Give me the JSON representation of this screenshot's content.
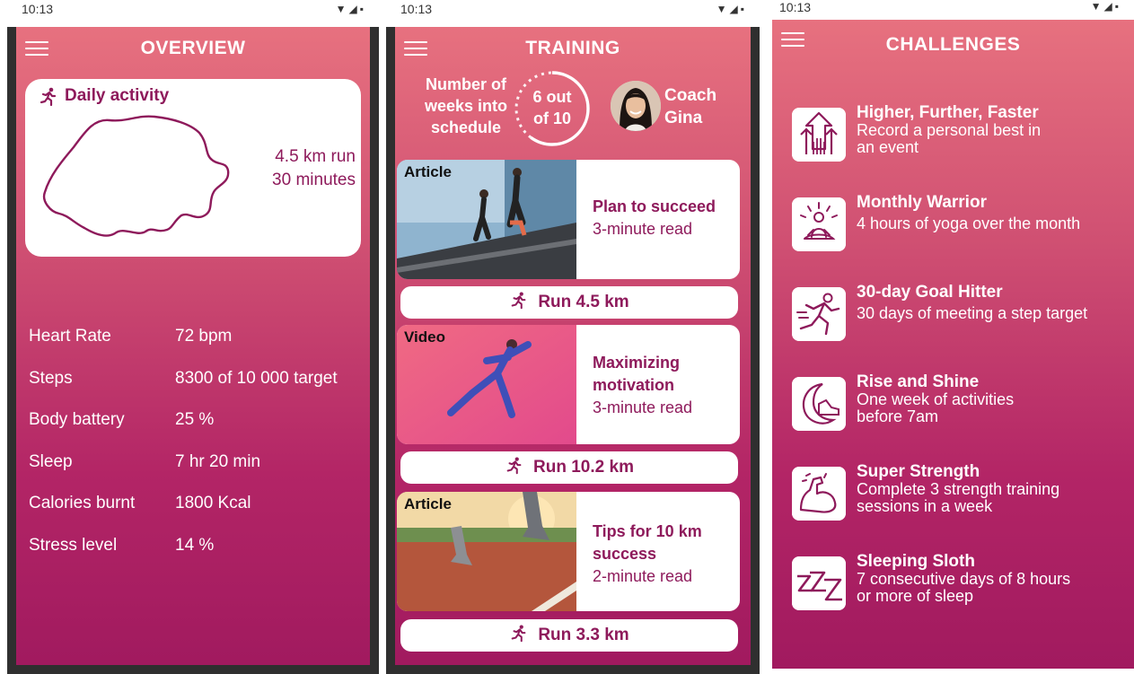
{
  "overview": {
    "status_time": "10:13",
    "title": "OVERVIEW",
    "daily": {
      "title": "Daily activity",
      "distance": "4.5 km run",
      "duration": "30 minutes"
    },
    "metrics": [
      {
        "label": "Heart Rate",
        "value": "72 bpm"
      },
      {
        "label": "Steps",
        "value": "8300 of 10 000 target"
      },
      {
        "label": "Body battery",
        "value": "25 %"
      },
      {
        "label": "Sleep",
        "value": "7 hr 20 min"
      },
      {
        "label": "Calories burnt",
        "value": "1800 Kcal"
      },
      {
        "label": "Stress level",
        "value": "14 %"
      }
    ]
  },
  "training": {
    "status_time": "10:13",
    "title": "TRAINING",
    "schedule_line1": "Number of",
    "schedule_line2": "weeks into",
    "schedule_line3": "schedule",
    "progress_line1": "6 out",
    "progress_line2": "of 10",
    "progress_fraction": 0.6,
    "coach_line1": "Coach",
    "coach_line2": "Gina",
    "cards": [
      {
        "tag": "Article",
        "title_line1": "Plan to succeed",
        "title_line2": "",
        "meta": "3-minute read",
        "run": "Run 4.5 km"
      },
      {
        "tag": "Video",
        "title_line1": "Maximizing",
        "title_line2": "motivation",
        "meta": "3-minute read",
        "run": "Run 10.2 km"
      },
      {
        "tag": "Article",
        "title_line1": "Tips for 10 km",
        "title_line2": "success",
        "meta": "2-minute read",
        "run": "Run 3.3 km"
      }
    ]
  },
  "challenges": {
    "status_time": "10:13",
    "title": "CHALLENGES",
    "items": [
      {
        "icon": "arrows-up-icon",
        "title": "Higher, Further, Faster",
        "desc_line1": "Record a personal best in",
        "desc_line2": "an event"
      },
      {
        "icon": "meditation-icon",
        "title": "Monthly Warrior",
        "desc_line1": "4 hours of yoga over the month",
        "desc_line2": ""
      },
      {
        "icon": "sprinter-icon",
        "title": "30-day Goal Hitter",
        "desc_line1": "30 days of meeting a step target",
        "desc_line2": ""
      },
      {
        "icon": "moon-shoe-icon",
        "title": "Rise and Shine",
        "desc_line1": "One week of activities",
        "desc_line2": "before 7am"
      },
      {
        "icon": "flexed-arm-icon",
        "title": "Super Strength",
        "desc_line1": "Complete 3 strength training",
        "desc_line2": "sessions in a week"
      },
      {
        "icon": "zzz-icon",
        "title": "Sleeping Sloth",
        "desc_line1": "7 consecutive days of 8 hours",
        "desc_line2": "or more of sleep"
      }
    ]
  },
  "colors": {
    "accent": "#8e1a5b",
    "gradient_top": "#e7717f",
    "gradient_bottom": "#a11a5f"
  }
}
